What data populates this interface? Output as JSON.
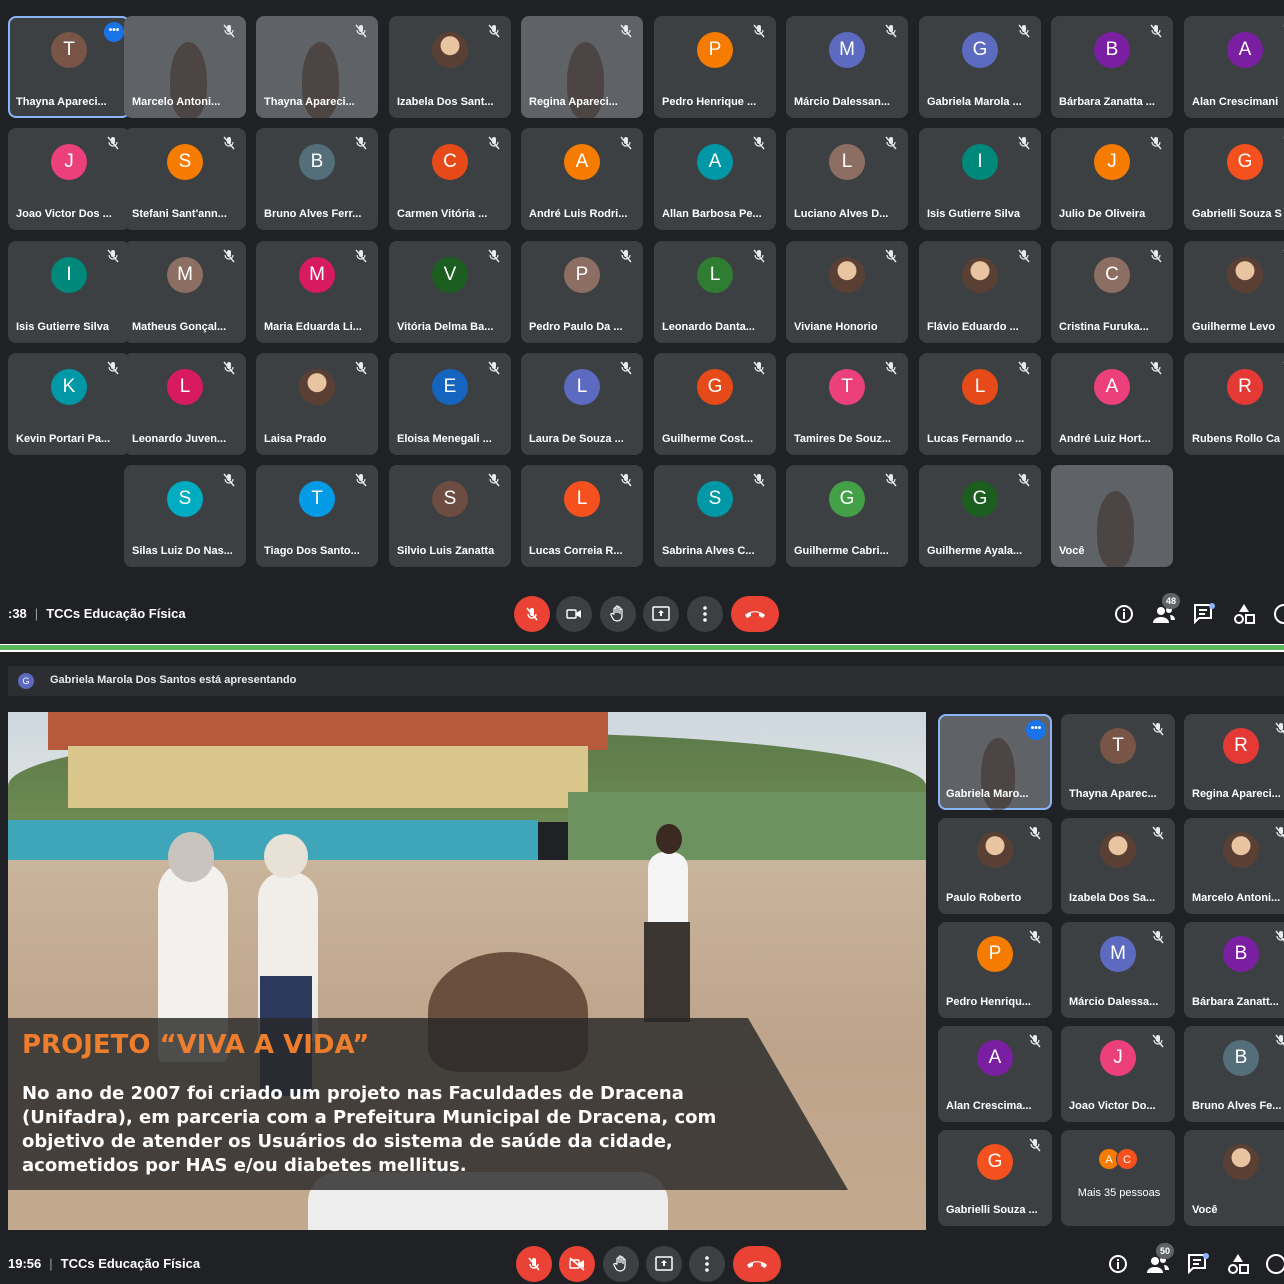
{
  "top_screenshot": {
    "participants": [
      {
        "name": "Thayna Apareci...",
        "initial": "T",
        "color": "#795548",
        "type": "avatar",
        "active": true
      },
      {
        "name": "Marcelo Antoni...",
        "type": "video",
        "video": "vid1"
      },
      {
        "name": "Thayna Apareci...",
        "type": "video",
        "video": "vid2"
      },
      {
        "name": "Izabela Dos Sant...",
        "type": "photo"
      },
      {
        "name": "Regina Apareci...",
        "type": "video",
        "video": "vid3"
      },
      {
        "name": "Pedro Henrique ...",
        "initial": "P",
        "color": "#f57c00",
        "type": "avatar"
      },
      {
        "name": "Márcio Dalessan...",
        "initial": "M",
        "color": "#5c6bc0",
        "type": "avatar"
      },
      {
        "name": "Gabriela Marola ...",
        "initial": "G",
        "color": "#5c6bc0",
        "type": "avatar"
      },
      {
        "name": "Bárbara Zanatta ...",
        "initial": "B",
        "color": "#7b1fa2",
        "type": "avatar"
      },
      {
        "name": "Alan Crescimani",
        "initial": "A",
        "color": "#7b1fa2",
        "type": "avatar"
      },
      {
        "name": "Joao Victor Dos ...",
        "initial": "J",
        "color": "#ec407a",
        "type": "avatar"
      },
      {
        "name": "Stefani Sant'ann...",
        "initial": "S",
        "color": "#f57c00",
        "type": "avatar"
      },
      {
        "name": "Bruno Alves Ferr...",
        "initial": "B",
        "color": "#546e7a",
        "type": "avatar"
      },
      {
        "name": "Carmen Vitória ...",
        "initial": "C",
        "color": "#e64a19",
        "type": "avatar"
      },
      {
        "name": "André Luis Rodri...",
        "initial": "A",
        "color": "#f57c00",
        "type": "avatar"
      },
      {
        "name": "Allan Barbosa Pe...",
        "initial": "A",
        "color": "#0097a7",
        "type": "avatar"
      },
      {
        "name": "Luciano Alves D...",
        "initial": "L",
        "color": "#8d6e63",
        "type": "avatar"
      },
      {
        "name": "Isis Gutierre Silva",
        "initial": "I",
        "color": "#00897b",
        "type": "avatar"
      },
      {
        "name": "Julio De Oliveira",
        "initial": "J",
        "color": "#f57c00",
        "type": "avatar"
      },
      {
        "name": "Gabrielli Souza S",
        "initial": "G",
        "color": "#f4511e",
        "type": "avatar"
      },
      {
        "name": "Isis Gutierre Silva",
        "initial": "I",
        "color": "#00897b",
        "type": "avatar"
      },
      {
        "name": "Matheus Gonçal...",
        "initial": "M",
        "color": "#8d6e63",
        "type": "avatar"
      },
      {
        "name": "Maria Eduarda Li...",
        "initial": "M",
        "color": "#d81b60",
        "type": "avatar"
      },
      {
        "name": "Vitória Delma Ba...",
        "initial": "V",
        "color": "#1b5e20",
        "type": "avatar"
      },
      {
        "name": "Pedro Paulo Da ...",
        "initial": "P",
        "color": "#8d6e63",
        "type": "avatar"
      },
      {
        "name": "Leonardo Danta...",
        "initial": "L",
        "color": "#2e7d32",
        "type": "avatar"
      },
      {
        "name": "Viviane Honorio",
        "type": "photo"
      },
      {
        "name": "Flávio Eduardo ...",
        "type": "photo"
      },
      {
        "name": "Cristina Furuka...",
        "initial": "C",
        "color": "#8d6e63",
        "type": "avatar"
      },
      {
        "name": "Guilherme Levo",
        "type": "photo"
      },
      {
        "name": "Kevin Portari Pa...",
        "initial": "K",
        "color": "#0097a7",
        "type": "avatar"
      },
      {
        "name": "Leonardo Juven...",
        "initial": "L",
        "color": "#d81b60",
        "type": "avatar"
      },
      {
        "name": "Laisa Prado",
        "type": "photo"
      },
      {
        "name": "Eloisa Menegali ...",
        "initial": "E",
        "color": "#1565c0",
        "type": "avatar"
      },
      {
        "name": "Laura De Souza ...",
        "initial": "L",
        "color": "#5c6bc0",
        "type": "avatar"
      },
      {
        "name": "Guilherme Cost...",
        "initial": "G",
        "color": "#e64a19",
        "type": "avatar"
      },
      {
        "name": "Tamires De Souz...",
        "initial": "T",
        "color": "#ec407a",
        "type": "avatar"
      },
      {
        "name": "Lucas Fernando ...",
        "initial": "L",
        "color": "#e64a19",
        "type": "avatar"
      },
      {
        "name": "André Luiz Hort...",
        "initial": "A",
        "color": "#ec407a",
        "type": "avatar"
      },
      {
        "name": "Rubens Rollo Ca",
        "initial": "R",
        "color": "#e53935",
        "type": "avatar"
      },
      {
        "name": "Silas Luiz Do Nas...",
        "initial": "S",
        "color": "#00acc1",
        "type": "avatar"
      },
      {
        "name": "Tiago Dos Santo...",
        "initial": "T",
        "color": "#039be5",
        "type": "avatar"
      },
      {
        "name": "Silvio Luis Zanatta",
        "initial": "S",
        "color": "#6d4c41",
        "type": "avatar"
      },
      {
        "name": "Lucas Correia R...",
        "initial": "L",
        "color": "#f4511e",
        "type": "avatar"
      },
      {
        "name": "Sabrina Alves C...",
        "initial": "S",
        "color": "#0097a7",
        "type": "avatar"
      },
      {
        "name": "Guilherme Cabri...",
        "initial": "G",
        "color": "#43a047",
        "type": "avatar"
      },
      {
        "name": "Guilherme Ayala...",
        "initial": "G",
        "color": "#1b5e20",
        "type": "avatar"
      },
      {
        "name": "Você",
        "type": "video",
        "video": "vid4"
      }
    ],
    "time": ":38",
    "meeting_title": "TCCs Educação Física",
    "people_count": "48"
  },
  "bottom_screenshot": {
    "presenting_initial": "G",
    "presenting_text": "Gabriela Marola Dos Santos está apresentando",
    "slide": {
      "title": "PROJETO “VIVA A VIDA”",
      "body": "No ano de 2007 foi criado um projeto nas Faculdades de Dracena (Unifadra), em parceria com a Prefeitura Municipal de Dracena, com objetivo de atender os Usuários do sistema de saúde da cidade, acometidos por HAS e/ou diabetes mellitus."
    },
    "sidebar": [
      {
        "name": "Gabriela Maro...",
        "type": "video",
        "video": "vid5",
        "active": true
      },
      {
        "name": "Thayna Aparec...",
        "initial": "T",
        "color": "#795548",
        "type": "avatar"
      },
      {
        "name": "Regina Apareci...",
        "initial": "R",
        "color": "#e53935",
        "type": "avatar"
      },
      {
        "name": "Paulo Roberto",
        "type": "photo"
      },
      {
        "name": "Izabela Dos Sa...",
        "type": "photo"
      },
      {
        "name": "Marcelo Antoni...",
        "type": "photo"
      },
      {
        "name": "Pedro Henriqu...",
        "initial": "P",
        "color": "#f57c00",
        "type": "avatar"
      },
      {
        "name": "Márcio Dalessa...",
        "initial": "M",
        "color": "#5c6bc0",
        "type": "avatar"
      },
      {
        "name": "Bárbara Zanatt...",
        "initial": "B",
        "color": "#7b1fa2",
        "type": "avatar"
      },
      {
        "name": "Alan Crescima...",
        "initial": "A",
        "color": "#7b1fa2",
        "type": "avatar"
      },
      {
        "name": "Joao Victor Do...",
        "initial": "J",
        "color": "#ec407a",
        "type": "avatar"
      },
      {
        "name": "Bruno Alves Fe...",
        "initial": "B",
        "color": "#546e7a",
        "type": "avatar"
      },
      {
        "name": "Gabrielli Souza ...",
        "initial": "G",
        "color": "#f4511e",
        "type": "avatar"
      },
      {
        "name": "Mais 35 pessoas",
        "type": "more",
        "initials": [
          "A",
          "C"
        ]
      },
      {
        "name": "Você",
        "type": "photo"
      }
    ],
    "time": "19:56",
    "meeting_title": "TCCs Educação Física",
    "people_count": "50"
  }
}
